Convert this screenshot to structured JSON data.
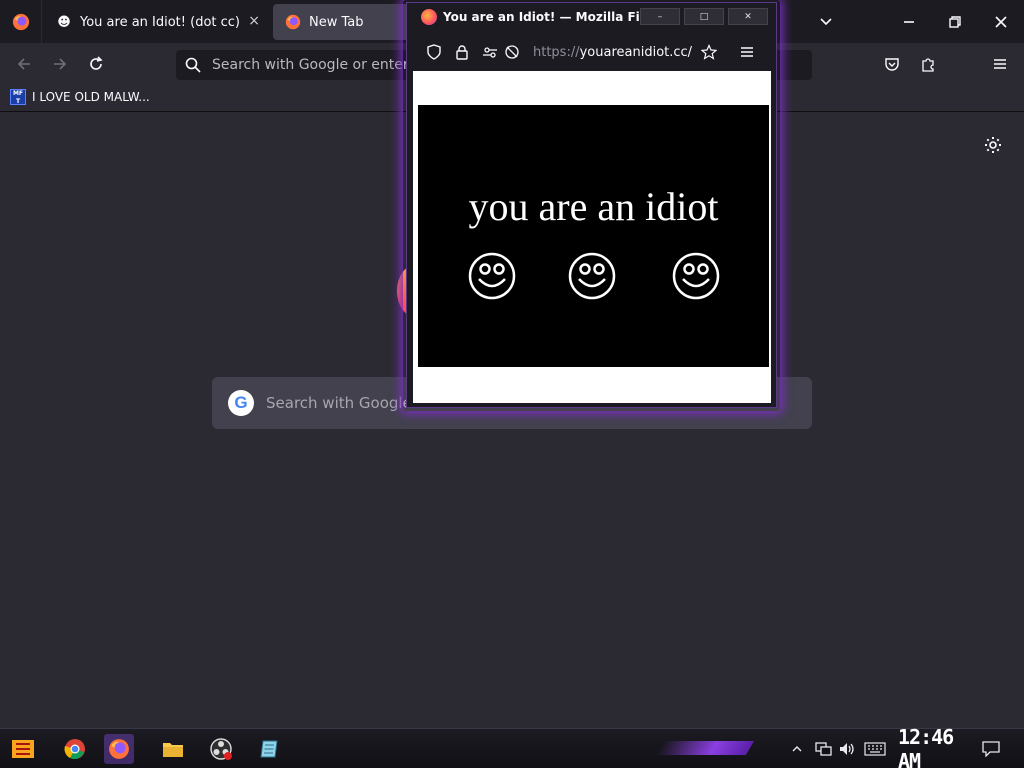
{
  "browser": {
    "tabs": [
      {
        "title": "You are an Idiot! (dot cc)",
        "favicon": "smiley-face-icon",
        "close": "×"
      },
      {
        "title": "New Tab",
        "favicon": "firefox-icon"
      }
    ],
    "url_placeholder": "Search with Google or enter address",
    "bookmarks": [
      {
        "label": "I LOVE OLD MALW...",
        "icon_text": "MF T"
      }
    ],
    "newtab_search_placeholder": "Search with Google or enter address"
  },
  "popup": {
    "title": "You are an Idiot! — Mozilla Fire...",
    "url_scheme": "https://",
    "url_host": "youareanidiot.cc/",
    "page_text": "you are an idiot",
    "controls": {
      "minimize": "–",
      "maximize": "□",
      "close": "✕"
    }
  },
  "taskbar": {
    "clock": "12:46 AM",
    "apps": [
      "start-icon",
      "chrome-icon",
      "firefox-icon",
      "file-explorer-icon",
      "obs-icon",
      "notepad-icon"
    ]
  },
  "colors": {
    "accent_purple": "#8a3fe0",
    "chrome_dark": "#1c1b22",
    "content_bg": "#2b2a33"
  }
}
